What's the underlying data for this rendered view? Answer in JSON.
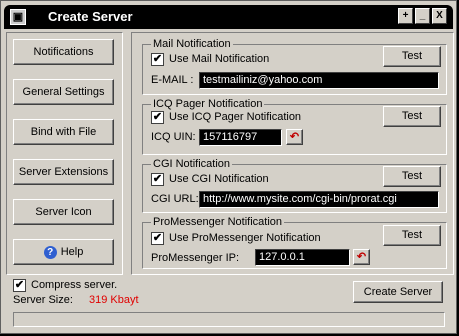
{
  "window": {
    "title": "Create Server",
    "title_buttons": [
      "+",
      "_",
      "X"
    ]
  },
  "nav": [
    {
      "label": "Notifications"
    },
    {
      "label": "General Settings"
    },
    {
      "label": "Bind with File"
    },
    {
      "label": "Server Extensions"
    },
    {
      "label": "Server Icon"
    },
    {
      "label": "Help"
    }
  ],
  "mail": {
    "group_title": "Mail Notification",
    "use_label": "Use Mail Notification",
    "checked": "✔",
    "test_label": "Test",
    "field_label": "E-MAIL :",
    "field_value": "testmailiniz@yahoo.com"
  },
  "icq": {
    "group_title": "ICQ Pager Notification",
    "use_label": "Use ICQ Pager Notification",
    "checked": "✔",
    "test_label": "Test",
    "field_label": "ICQ UIN:",
    "field_value": "157116797"
  },
  "cgi": {
    "group_title": "CGI Notification",
    "use_label": "Use CGI Notification",
    "checked": "✔",
    "test_label": "Test",
    "field_label": "CGI URL:",
    "field_value": "http://www.mysite.com/cgi-bin/prorat.cgi"
  },
  "promessenger": {
    "group_title": "ProMessenger Notification",
    "use_label": "Use ProMessenger Notification",
    "checked": "✔",
    "test_label": "Test",
    "field_label": "ProMessenger IP:",
    "field_value": "127.0.0.1"
  },
  "footer": {
    "compress_label": "Compress server.",
    "compress_checked": "✔",
    "size_label": "Server Size:",
    "size_value": "319 Kbayt",
    "create_label": "Create Server"
  },
  "colors": {
    "size_value": "#e00000",
    "field_bg": "#000000",
    "field_text": "#ffffff"
  }
}
